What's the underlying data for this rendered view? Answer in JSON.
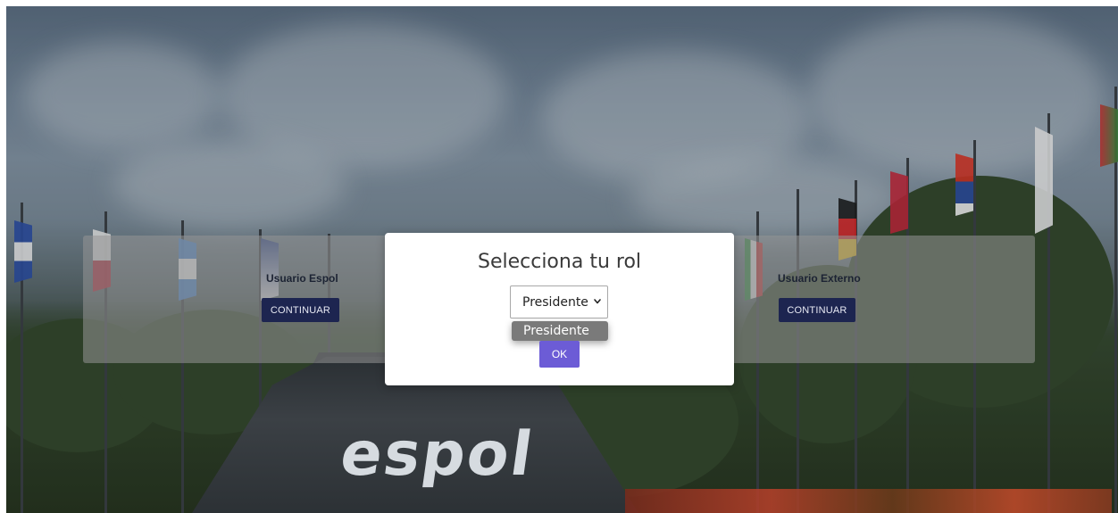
{
  "background": {
    "logo_text": "espol"
  },
  "cards": {
    "espol": {
      "title": "Usuario Espol",
      "button_label": "CONTINUAR"
    },
    "externo": {
      "title": "Usuario Externo",
      "button_label": "CONTINUAR"
    }
  },
  "modal": {
    "title": "Selecciona tu rol",
    "select": {
      "value": "Presidente",
      "options": [
        "Presidente"
      ]
    },
    "dropdown_highlighted_option": "Presidente",
    "ok_label": "OK"
  },
  "colors": {
    "accent": "#6c5cd6",
    "continue_button": "#1d2550"
  },
  "icons": {
    "select_caret": "chevron-down-icon"
  }
}
